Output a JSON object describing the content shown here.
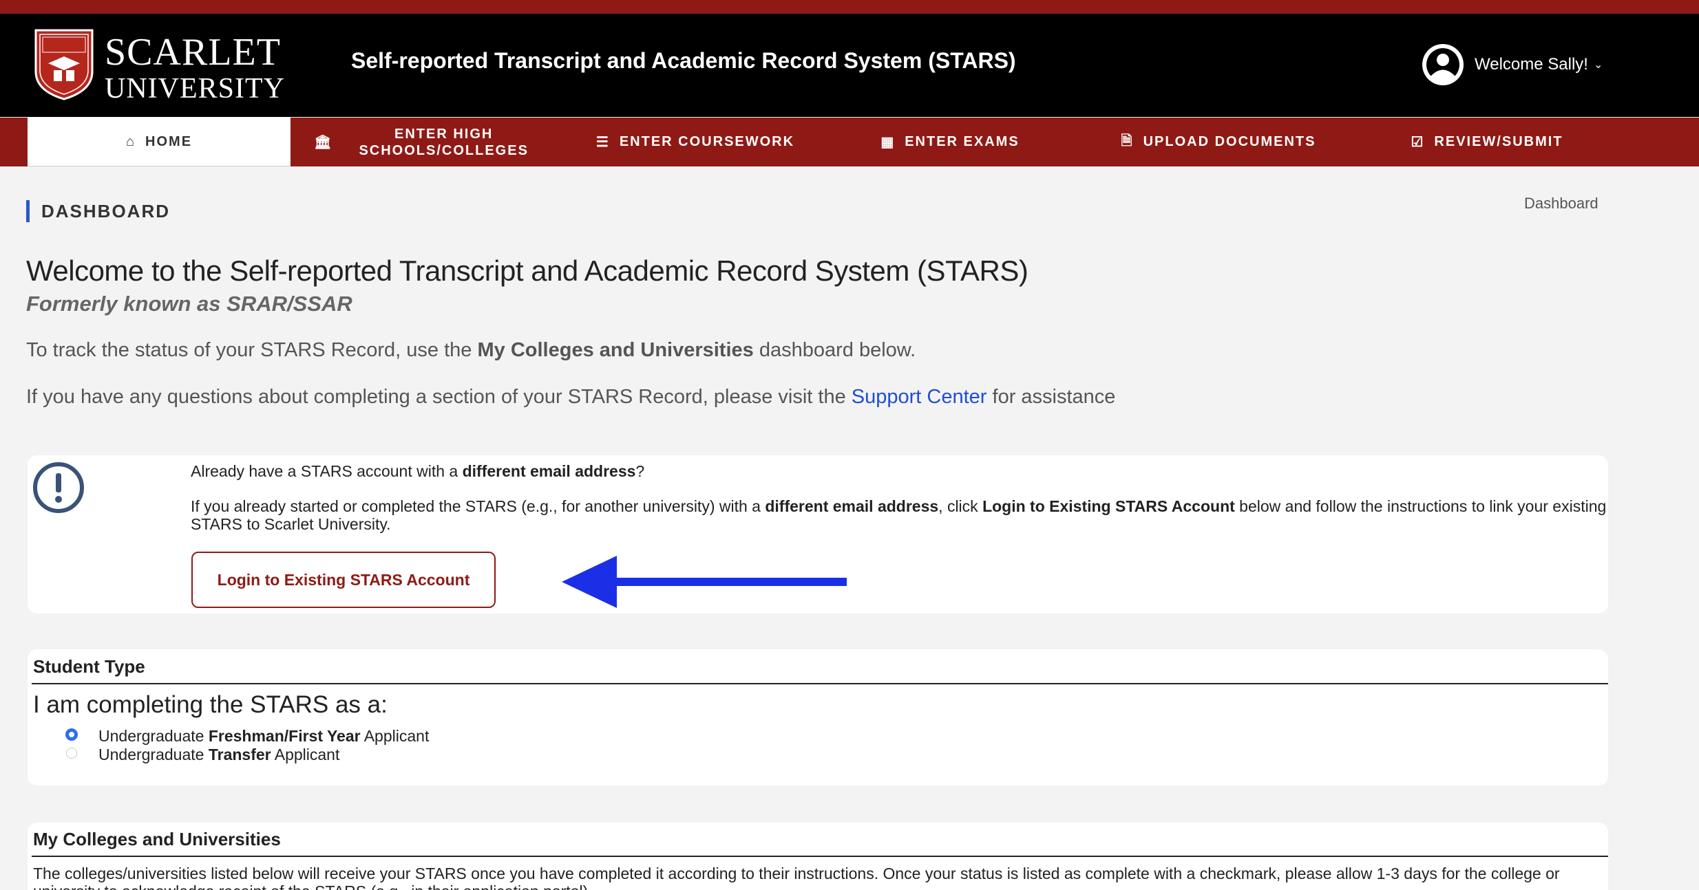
{
  "brand": {
    "line1": "SCARLET",
    "line2": "UNIVERSITY",
    "accent_color": "#8f1a15"
  },
  "header": {
    "app_title": "Self-reported Transcript and Academic Record System (STARS)",
    "user_greeting": "Welcome Sally!",
    "user_icon": "user-circle-icon",
    "caret_icon": "chevron-down-icon"
  },
  "nav": {
    "items": [
      {
        "label": "HOME",
        "icon": "home-icon",
        "active": true
      },
      {
        "label_line1": "ENTER HIGH",
        "label_line2": "SCHOOLS/COLLEGES",
        "icon": "institution-icon"
      },
      {
        "label": "ENTER COURSEWORK",
        "icon": "list-icon"
      },
      {
        "label": "ENTER EXAMS",
        "icon": "table-icon"
      },
      {
        "label": "UPLOAD DOCUMENTS",
        "icon": "document-icon"
      },
      {
        "label": "REVIEW/SUBMIT",
        "icon": "check-square-icon"
      }
    ]
  },
  "page": {
    "section_label": "DASHBOARD",
    "breadcrumb": "Dashboard",
    "title": "Welcome to the Self-reported Transcript and Academic Record System (STARS)",
    "subtitle": "Formerly known as SRAR/SSAR",
    "intro1_pre": "To track the status of your STARS Record, use the ",
    "intro1_bold": "My Colleges and Universities",
    "intro1_post": " dashboard below.",
    "intro2_pre": "If you have any questions about completing a section of your STARS Record, please visit the ",
    "intro2_link": "Support Center",
    "intro2_post": " for assistance"
  },
  "existing_account": {
    "line1_pre": "Already have a STARS account with a ",
    "line1_bold": "different email address",
    "line1_post": "?",
    "line2_a": "If you already started or completed the STARS (e.g., for another university) with a ",
    "line2_b": "different email address",
    "line2_c": ", click ",
    "line2_d": "Login to Existing STARS Account",
    "line2_e": " below and follow the instructions to link your existing STARS to Scarlet University.",
    "button_label": "Login to Existing STARS Account",
    "arrow_color": "#1a2fe6"
  },
  "student_type": {
    "title": "Student Type",
    "question": "I am completing the STARS as a:",
    "options": [
      {
        "pre": "Undergraduate ",
        "bold": "Freshman/First Year",
        "post": " Applicant",
        "selected": true
      },
      {
        "pre": "Undergraduate ",
        "bold": "Transfer",
        "post": " Applicant",
        "selected": false
      }
    ]
  },
  "colleges": {
    "title": "My Colleges and Universities",
    "text": "The colleges/universities listed below will receive your STARS once you have completed it according to their instructions. Once your status is listed as complete with a checkmark, please allow 1-3 days for the college or university to acknowledge receipt of the STARS (e.g., in their application portal)."
  }
}
